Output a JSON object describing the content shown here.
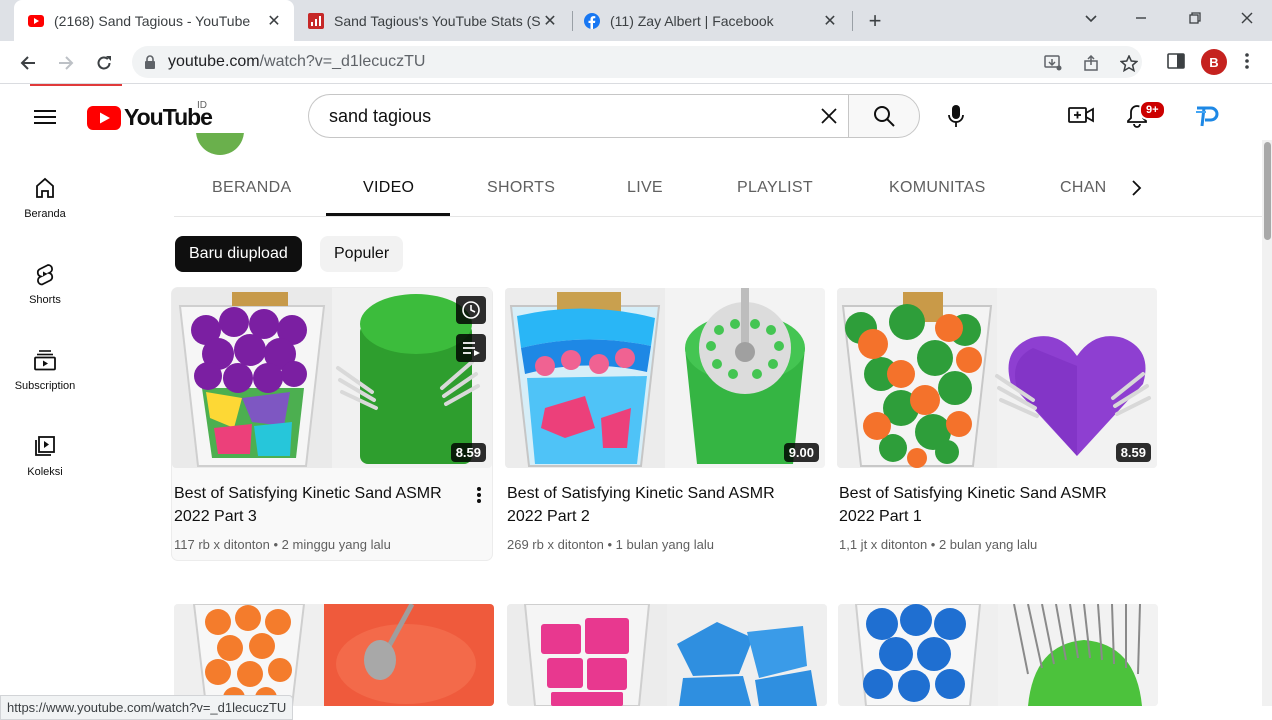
{
  "browser": {
    "tabs": [
      {
        "title": "(2168) Sand Tagious - YouTube",
        "active": true
      },
      {
        "title": "Sand Tagious's YouTube Stats (S",
        "active": false
      },
      {
        "title": "(11) Zay Albert | Facebook",
        "active": false
      }
    ],
    "url_host": "youtube.com",
    "url_path": "/watch?v=_d1lecuczTU",
    "profile_initial": "B"
  },
  "youtube": {
    "logo_text": "YouTube",
    "country_code": "ID",
    "search_value": "sand tagious",
    "notifications_badge": "9+"
  },
  "guide": [
    {
      "label": "Beranda",
      "icon": "home-icon"
    },
    {
      "label": "Shorts",
      "icon": "shorts-icon"
    },
    {
      "label": "Subscription",
      "icon": "subscriptions-icon"
    },
    {
      "label": "Koleksi",
      "icon": "library-icon"
    }
  ],
  "channel_tabs": [
    "BERANDA",
    "VIDEO",
    "SHORTS",
    "LIVE",
    "PLAYLIST",
    "KOMUNITAS",
    "CHAN"
  ],
  "active_channel_tab": "VIDEO",
  "chips": [
    {
      "label": "Baru diupload",
      "active": true
    },
    {
      "label": "Populer",
      "active": false
    }
  ],
  "videos": [
    {
      "title": "Best of Satisfying Kinetic Sand ASMR 2022 Part 3",
      "views": "117 rb x ditonton",
      "age": "2 minggu yang lalu",
      "duration": "8.59",
      "hovered": true
    },
    {
      "title": "Best of Satisfying Kinetic Sand ASMR 2022 Part 2",
      "views": "269 rb x ditonton",
      "age": "1 bulan yang lalu",
      "duration": "9.00",
      "hovered": false
    },
    {
      "title": "Best of Satisfying Kinetic Sand ASMR 2022 Part 1",
      "views": "1,1 jt x ditonton",
      "age": "2 bulan yang lalu",
      "duration": "8.59",
      "hovered": false
    }
  ],
  "status_url": "https://www.youtube.com/watch?v=_d1lecuczTU",
  "colors": {
    "youtube_red": "#ff0000",
    "badge_red": "#cc0000",
    "chrome_tabstrip": "#dee1e6"
  }
}
